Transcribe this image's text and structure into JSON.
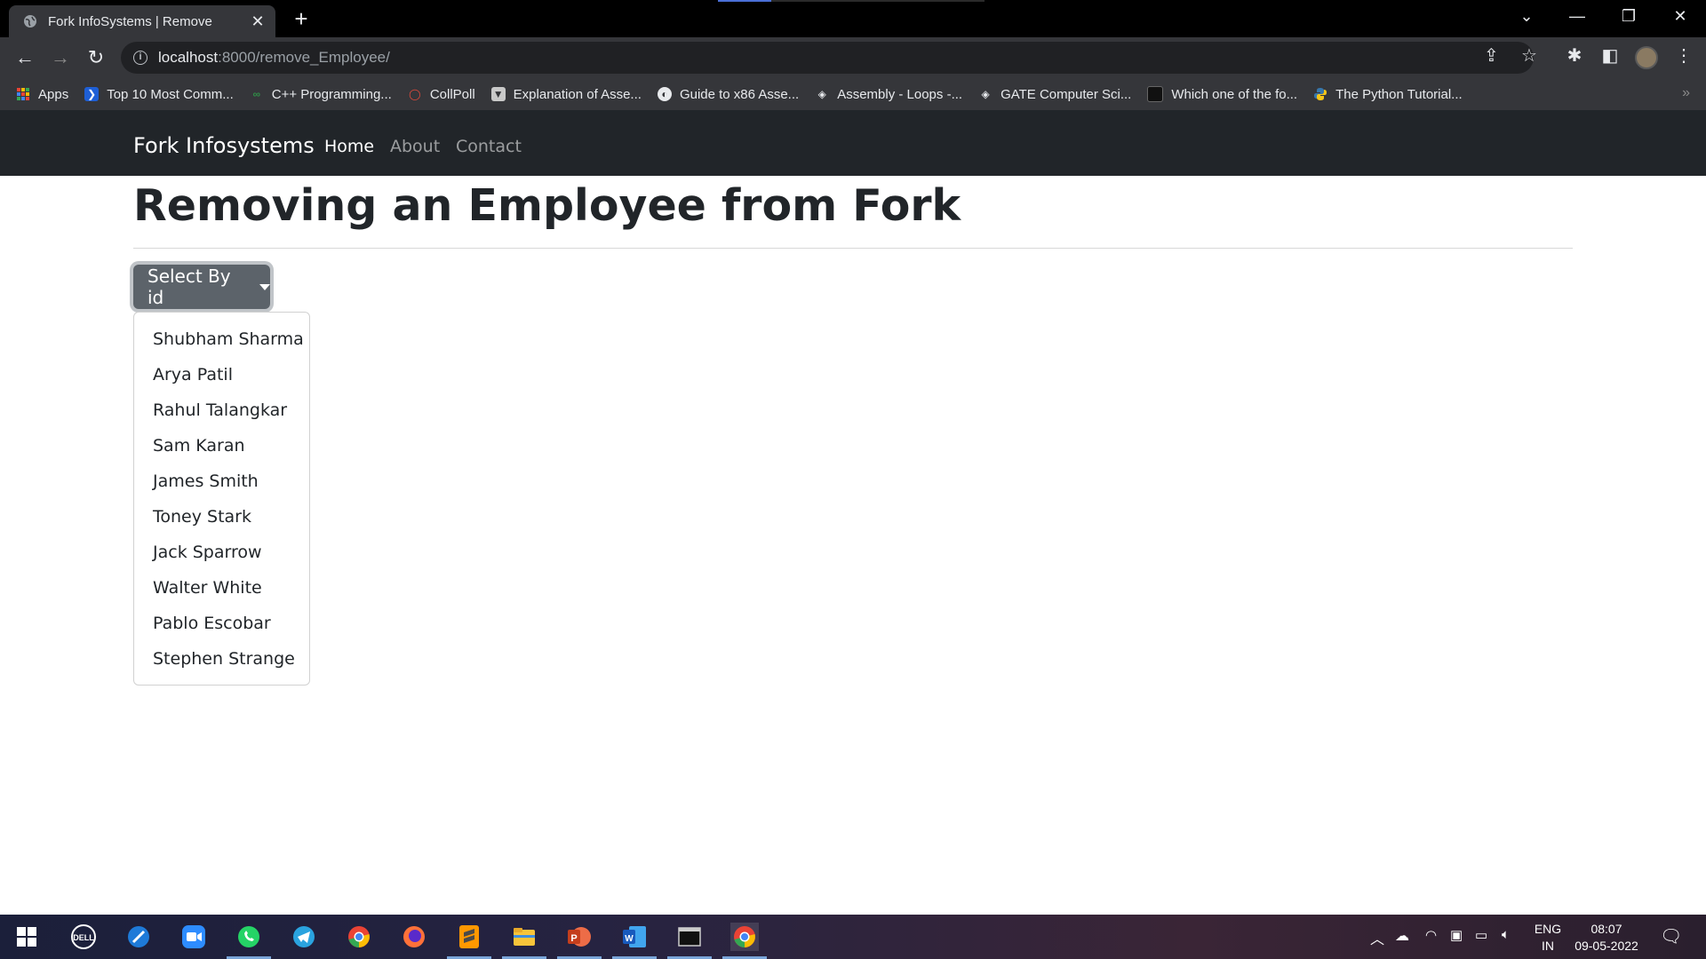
{
  "browser": {
    "tab_title": "Fork InfoSystems | Remove",
    "new_tab_symbol": "+",
    "url_host": "localhost",
    "url_path": ":8000/remove_Employee/",
    "bookmarks": [
      {
        "label": "Apps",
        "icon": "apps-grid-icon",
        "color": "#e84c3d"
      },
      {
        "label": "Top 10 Most Comm...",
        "icon": "bookmark-blue-icon",
        "color": "#1e5fd6"
      },
      {
        "label": "C++ Programming...",
        "icon": "gfg-icon",
        "color": "#2f8d46"
      },
      {
        "label": "CollPoll",
        "icon": "collpoll-icon",
        "color": "#e64a3b"
      },
      {
        "label": "Explanation of Asse...",
        "icon": "site-icon",
        "color": "#c9c9c9"
      },
      {
        "label": "Guide to x86 Asse...",
        "icon": "globe-icon",
        "color": "#e8eaed"
      },
      {
        "label": "Assembly - Loops -...",
        "icon": "tutorialspoint-icon",
        "color": "#e8eaed"
      },
      {
        "label": "GATE Computer Sci...",
        "icon": "tutorialspoint-icon",
        "color": "#e8eaed"
      },
      {
        "label": "Which one of the fo...",
        "icon": "doc-icon",
        "color": "#e8eaed"
      },
      {
        "label": "The Python Tutorial...",
        "icon": "python-icon",
        "color": "#f5c518"
      }
    ]
  },
  "navbar": {
    "brand": "Fork Infosystems",
    "links": [
      "Home",
      "About",
      "Contact"
    ],
    "active": "Home"
  },
  "main": {
    "heading": "Removing an Employee from Fork",
    "dropdown_label": "Select By id",
    "dropdown_items": [
      "Shubham Sharma",
      "Arya Patil",
      "Rahul Talangkar",
      "Sam Karan",
      "James Smith",
      "Toney Stark",
      "Jack Sparrow",
      "Walter White",
      "Pablo Escobar",
      "Stephen Strange"
    ]
  },
  "taskbar": {
    "apps": [
      "windows-start-icon",
      "dell-icon",
      "browser-icon",
      "zoom-icon",
      "whatsapp-icon",
      "telegram-icon",
      "chrome-icon",
      "firefox-icon",
      "sublime-icon",
      "file-explorer-icon",
      "powerpoint-icon",
      "word-icon",
      "terminal-icon",
      "chrome-active-icon"
    ],
    "lang_top": "ENG",
    "lang_bottom": "IN",
    "time": "08:07",
    "date": "09-05-2022"
  },
  "colors": {
    "navbar_bg": "#212529",
    "button_bg": "#5c636a",
    "chrome_bg": "#35363a"
  }
}
